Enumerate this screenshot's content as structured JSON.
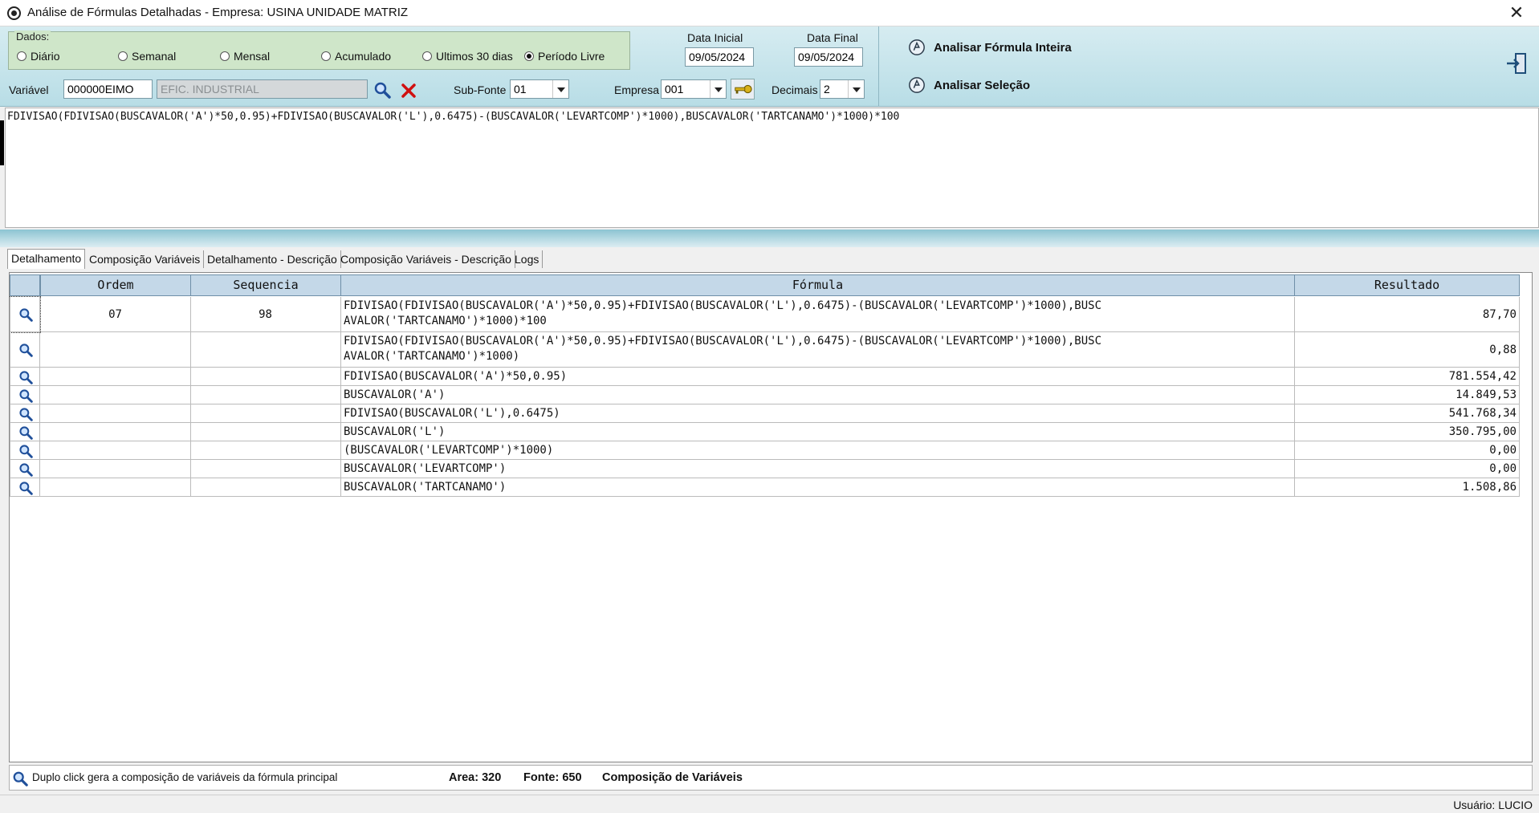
{
  "window": {
    "title": "Análise de Fórmulas Detalhadas  -  Empresa: USINA UNIDADE MATRIZ"
  },
  "dados": {
    "legend": "Dados:",
    "options": [
      "Diário",
      "Semanal",
      "Mensal",
      "Acumulado",
      "Ultimos 30 dias",
      "Período Livre"
    ],
    "selected": "Período Livre"
  },
  "dates": {
    "inicial_label": "Data Inicial",
    "inicial_value": "09/05/2024",
    "final_label": "Data Final",
    "final_value": "09/05/2024"
  },
  "filters": {
    "variavel_label": "Variável",
    "variavel_code": "000000EIMO",
    "variavel_desc": "EFIC. INDUSTRIAL",
    "subfonte_label": "Sub-Fonte",
    "subfonte_value": "01",
    "empresa_label": "Empresa",
    "empresa_value": "001",
    "decimais_label": "Decimais",
    "decimais_value": "2"
  },
  "actions": {
    "analisar_inteira": "Analisar Fórmula Inteira",
    "analisar_selecao": "Analisar Seleção"
  },
  "formula": "FDIVISAO(FDIVISAO(BUSCAVALOR('A')*50,0.95)+FDIVISAO(BUSCAVALOR('L'),0.6475)-(BUSCAVALOR('LEVARTCOMP')*1000),BUSCAVALOR('TARTCANAMO')*1000)*100",
  "tabs": [
    "Detalhamento",
    "Composição Variáveis",
    "Detalhamento - Descrição",
    "Composição Variáveis - Descrição",
    "Logs"
  ],
  "active_tab": "Detalhamento",
  "grid": {
    "headers": [
      "Ordem",
      "Sequencia",
      "Fórmula",
      "Resultado"
    ],
    "rows": [
      {
        "ordem": "07",
        "sequencia": "98",
        "formula_l1": "FDIVISAO(FDIVISAO(BUSCAVALOR('A')*50,0.95)+FDIVISAO(BUSCAVALOR('L'),0.6475)-(BUSCAVALOR('LEVARTCOMP')*1000),BUSC",
        "formula_l2": "AVALOR('TARTCANAMO')*1000)*100",
        "resultado": "87,70"
      },
      {
        "ordem": "",
        "sequencia": "",
        "formula_l1": "FDIVISAO(FDIVISAO(BUSCAVALOR('A')*50,0.95)+FDIVISAO(BUSCAVALOR('L'),0.6475)-(BUSCAVALOR('LEVARTCOMP')*1000),BUSC",
        "formula_l2": "AVALOR('TARTCANAMO')*1000)",
        "resultado": "0,88"
      },
      {
        "ordem": "",
        "sequencia": "",
        "formula_l1": "FDIVISAO(BUSCAVALOR('A')*50,0.95)",
        "formula_l2": "",
        "resultado": "781.554,42"
      },
      {
        "ordem": "",
        "sequencia": "",
        "formula_l1": "BUSCAVALOR('A')",
        "formula_l2": "",
        "resultado": "14.849,53"
      },
      {
        "ordem": "",
        "sequencia": "",
        "formula_l1": "FDIVISAO(BUSCAVALOR('L'),0.6475)",
        "formula_l2": "",
        "resultado": "541.768,34"
      },
      {
        "ordem": "",
        "sequencia": "",
        "formula_l1": "BUSCAVALOR('L')",
        "formula_l2": "",
        "resultado": "350.795,00"
      },
      {
        "ordem": "",
        "sequencia": "",
        "formula_l1": "(BUSCAVALOR('LEVARTCOMP')*1000)",
        "formula_l2": "",
        "resultado": "0,00"
      },
      {
        "ordem": "",
        "sequencia": "",
        "formula_l1": "BUSCAVALOR('LEVARTCOMP')",
        "formula_l2": "",
        "resultado": "0,00"
      },
      {
        "ordem": "",
        "sequencia": "",
        "formula_l1": "BUSCAVALOR('TARTCANAMO')",
        "formula_l2": "",
        "resultado": "1.508,86"
      }
    ]
  },
  "status": {
    "hint": "Duplo click gera a composição de variáveis da fórmula principal",
    "area": "Area:  320",
    "fonte": "Fonte:  650",
    "composicao": "Composição de Variáveis"
  },
  "footer": {
    "usuario": "Usuário: LUCIO"
  },
  "colors": {
    "header_bg": "#c4d8e8",
    "dados_bg": "#cfe6c9",
    "toolbar_bg": "#b8dde6",
    "delete_red": "#d01010"
  },
  "icons": [
    "app-icon",
    "close-icon",
    "search-icon",
    "clear-x-icon",
    "key-icon",
    "analyze-icon",
    "exit-icon",
    "magnifier-icon"
  ]
}
